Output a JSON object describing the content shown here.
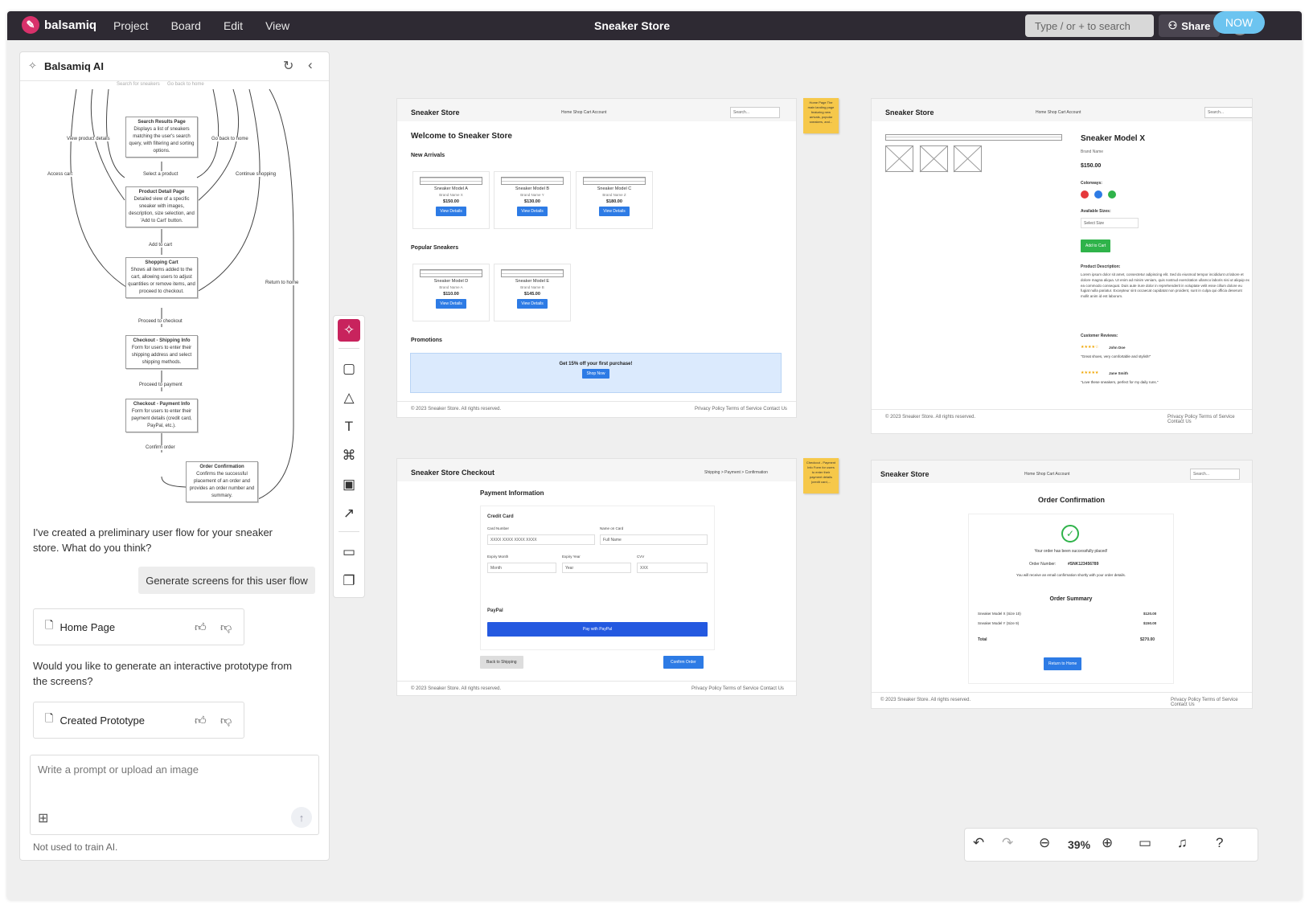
{
  "app": {
    "brand": "balsamiq",
    "menu": [
      "Project",
      "Board",
      "Edit",
      "View"
    ],
    "title": "Sneaker Store",
    "search_placeholder": "Type / or + to search",
    "share": "Share",
    "badge": "NOW"
  },
  "ai_panel": {
    "title": "Balsamiq AI",
    "flow": {
      "top_label_left": "Search for sneakers",
      "top_label_right": "Go back to home",
      "nodes": [
        {
          "title": "Search Results Page",
          "desc": "Displays a list of sneakers matching the user's search query, with filtering and sorting options."
        },
        {
          "title": "Product Detail Page",
          "desc": "Detailed view of a specific sneaker with images, description, size selection, and 'Add to Cart' button."
        },
        {
          "title": "Shopping Cart",
          "desc": "Shows all items added to the cart, allowing users to adjust quantities or remove items, and proceed to checkout."
        },
        {
          "title": "Checkout - Shipping Info",
          "desc": "Form for users to enter their shipping address and select shipping methods."
        },
        {
          "title": "Checkout - Payment Info",
          "desc": "Form for users to enter their payment details (credit card, PayPal, etc.)."
        },
        {
          "title": "Order Confirmation",
          "desc": "Confirms the successful placement of an order and provides an order number and summary."
        }
      ],
      "edge_labels": [
        "View product details",
        "Go back to home",
        "Access cart",
        "Select a product",
        "Continue shopping",
        "Add to cart",
        "Return to home",
        "Proceed to checkout",
        "Proceed to payment",
        "Confirm order"
      ]
    },
    "message1": "I've created a preliminary user flow for your sneaker store. What do you think?",
    "generate_btn": "Generate screens for this user flow",
    "card1": "Home Page",
    "message2": "Would you like to generate an interactive prototype from the screens?",
    "card2": "Created Prototype",
    "prompt_placeholder": "Write a prompt or upload an image",
    "footer_note": "Not used to train AI."
  },
  "wf_home": {
    "brand": "Sneaker Store",
    "links": "Home  Shop  Cart  Account",
    "search": "Search...",
    "welcome": "Welcome to Sneaker Store",
    "new_arrivals": "New Arrivals",
    "products": [
      {
        "name": "Sneaker Model A",
        "brand": "Brand Name X",
        "price": "$150.00"
      },
      {
        "name": "Sneaker Model B",
        "brand": "Brand Name Y",
        "price": "$130.00"
      },
      {
        "name": "Sneaker Model C",
        "brand": "Brand Name Z",
        "price": "$180.00"
      }
    ],
    "popular": "Popular Sneakers",
    "popular_products": [
      {
        "name": "Sneaker Model D",
        "brand": "Brand Name A",
        "price": "$110.00"
      },
      {
        "name": "Sneaker Model E",
        "brand": "Brand Name B",
        "price": "$145.00"
      }
    ],
    "view_details": "View Details",
    "promotions": "Promotions",
    "promo_text": "Get 15% off your first purchase!",
    "shop_now": "Shop Now",
    "footer_left": "© 2023 Sneaker Store. All rights reserved.",
    "footer_right": "Privacy Policy  Terms of Service  Contact Us",
    "sticky": "Home Page  The main landing page featuring new arrivals, popular sneakers, and..."
  },
  "wf_product": {
    "brand": "Sneaker Store",
    "links": "Home  Shop  Cart  Account",
    "search": "Search...",
    "name": "Sneaker Model X",
    "brand_name": "Brand Name",
    "price": "$150.00",
    "colorways": "Colorways:",
    "sizes": "Available Sizes:",
    "select_size": "Select Size",
    "add_to_cart": "Add to Cart",
    "desc_label": "Product Description:",
    "desc": "Lorem ipsum dolor sit amet, consectetur adipiscing elit. Sed do eiusmod tempor incididunt ut labore et dolore magna aliqua. Ut enim ad minim veniam, quis nostrud exercitation ullamco laboris nisi ut aliquip ex ea commodo consequat. Duis aute irure dolor in reprehenderit in voluptate velit esse cillum dolore eu fugiat nulla pariatur. Excepteur sint occaecat cupidatat non proident, sunt in culpa qui officia deserunt mollit anim id est laborum.",
    "reviews_label": "Customer Reviews:",
    "reviews": [
      {
        "stars": "★★★★☆",
        "author": "John Doe",
        "text": "\"Great shoes, very comfortable and stylish!\""
      },
      {
        "stars": "★★★★★",
        "author": "Jane Smith",
        "text": "\"Love these sneakers, perfect for my daily runs.\""
      }
    ],
    "footer_left": "© 2023 Sneaker Store. All rights reserved.",
    "footer_right": "Privacy Policy  Terms of Service  Contact Us",
    "colors": {
      "red": "#e5383b",
      "blue": "#2d7be5",
      "green": "#2fb34a"
    }
  },
  "wf_checkout": {
    "brand": "Sneaker Store Checkout",
    "steps": "Shipping > Payment > Confirmation",
    "heading": "Payment Information",
    "credit_card": "Credit Card",
    "card_number_label": "Card Number",
    "card_number": "XXXX XXXX XXXX XXXX",
    "name_label": "Name on Card",
    "name": "Full Name",
    "month_label": "Expiry Month",
    "month": "Month",
    "year_label": "Expiry Year",
    "year": "Year",
    "cvv_label": "CVV",
    "cvv": "XXX",
    "paypal": "PayPal",
    "paypal_btn": "Pay with PayPal",
    "back": "Back to Shipping",
    "confirm": "Confirm Order",
    "footer_left": "© 2023 Sneaker Store. All rights reserved.",
    "footer_right": "Privacy Policy  Terms of Service  Contact Us",
    "sticky": "Checkout - Payment Info  Form for users to enter their payment details (credit card,..."
  },
  "wf_confirm": {
    "brand": "Sneaker Store",
    "links": "Home  Shop  Cart  Account",
    "search": "Search...",
    "heading": "Order Confirmation",
    "success": "Your order has been successfully placed!",
    "order_label": "Order Number:",
    "order_number": "#SNK123456789",
    "email_note": "You will receive an email confirmation shortly with your order details.",
    "summary": "Order Summary",
    "items": [
      {
        "name": "Sneaker Model X (Size 10)",
        "price": "$120.00"
      },
      {
        "name": "Sneaker Model Y (Size 9)",
        "price": "$150.00"
      }
    ],
    "total_label": "Total",
    "total": "$270.00",
    "return_btn": "Return to Home",
    "footer_left": "© 2023 Sneaker Store. All rights reserved.",
    "footer_right": "Privacy Policy  Terms of Service  Contact Us"
  },
  "controls": {
    "zoom": "39%"
  }
}
